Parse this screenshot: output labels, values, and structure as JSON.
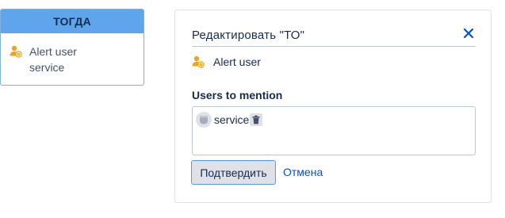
{
  "then_card": {
    "header": "ТОГДА",
    "action": {
      "icon": "user-mention-icon",
      "label": "Alert user service"
    }
  },
  "edit_panel": {
    "title": "Редактировать \"ТО\"",
    "close_icon": "close-icon",
    "action": {
      "icon": "user-mention-icon",
      "label": "Alert user"
    },
    "users_field": {
      "label": "Users to mention",
      "chips": [
        {
          "name": "service",
          "avatar_icon": "user-avatar-icon",
          "remove_icon": "trash-icon"
        }
      ]
    },
    "confirm_label": "Подтвердить",
    "cancel_label": "Отмена"
  },
  "colors": {
    "header_blue": "#5ea5ec",
    "icon_orange": "#f0a41b",
    "link_blue": "#0052cc",
    "focus_blue": "#4c9aff"
  }
}
